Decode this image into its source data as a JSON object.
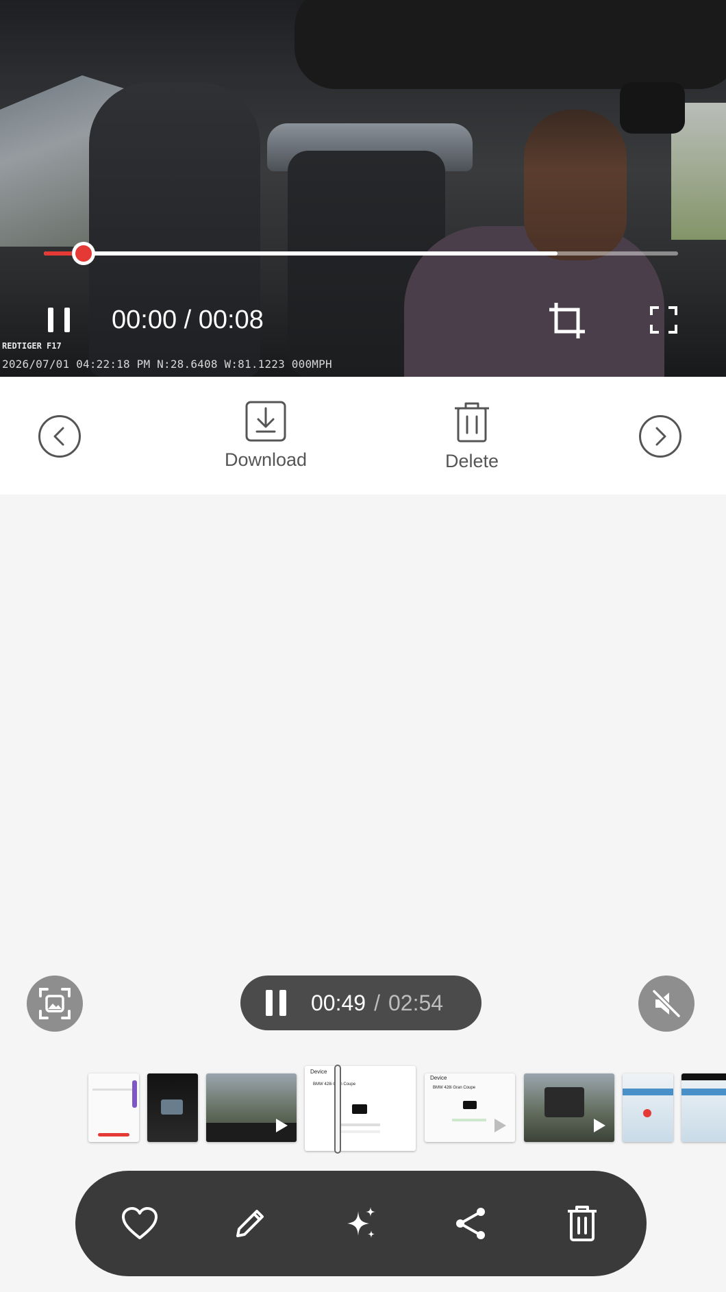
{
  "video": {
    "stamp_brand": "REDTIGER F17",
    "stamp_info": "2026/07/01 04:22:18 PM N:28.6408 W:81.1223 000MPH",
    "time_display": "00:00 / 00:08",
    "progress_played": 0.063,
    "progress_buffered": 0.81
  },
  "actions": {
    "download_label": "Download",
    "delete_label": "Delete"
  },
  "player": {
    "current_time": "00:49",
    "separator": "/",
    "total_time": "02:54"
  },
  "filmstrip": {
    "thumbs": [
      {
        "kind": "app"
      },
      {
        "kind": "video-dark"
      },
      {
        "kind": "video-photo"
      },
      {
        "kind": "app-selected",
        "header": "Device",
        "title": "BMW 428i Gran Coupe"
      },
      {
        "kind": "app",
        "header": "Device",
        "title": "BMW 428i Gran Coupe"
      },
      {
        "kind": "video-photo"
      },
      {
        "kind": "map"
      },
      {
        "kind": "map"
      }
    ]
  },
  "toolbar": {
    "icons": [
      "heart-icon",
      "pencil-icon",
      "sparkle-icon",
      "share-icon",
      "trash-icon"
    ]
  },
  "colors": {
    "progress_red": "#e53935",
    "toolbar_bg": "#3a3a3a",
    "pill_bg": "#4b4b4b",
    "page_bg": "#f5f5f5"
  }
}
